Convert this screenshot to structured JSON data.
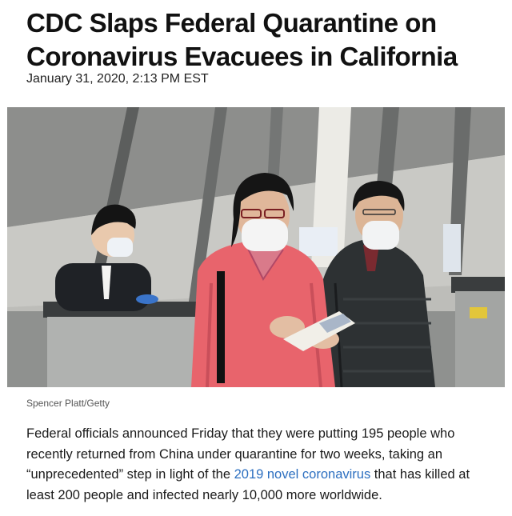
{
  "article": {
    "headline": "CDC Slaps Federal Quarantine on Coronavirus Evacuees in California",
    "dateline": "January 31, 2020, 2:13 PM EST",
    "photo": {
      "subject": "travelers in face masks at an airport check-in counter",
      "caption": "Spencer Platt/Getty"
    },
    "body": {
      "before_link": "Federal officials announced Friday that they were putting 195 people who recently returned from China under quarantine for two weeks, taking an “unprecedented” step in light of the ",
      "link_text": "2019 novel coronavirus",
      "after_link": " that has killed at least 200 people and infected nearly 10,000 more worldwide."
    }
  },
  "colors": {
    "link": "#2c6fc0",
    "headline": "#111111",
    "pink_jacket": "#e8646c",
    "dark_jacket": "#2d3133"
  }
}
